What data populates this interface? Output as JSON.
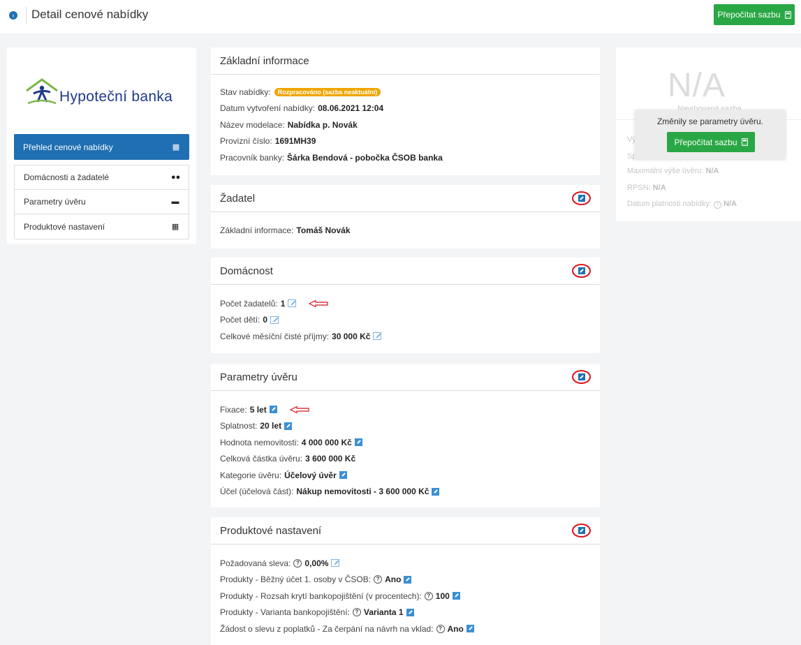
{
  "header": {
    "title": "Detail cenové nabídky",
    "recalc_button": "Přepočítat sazbu"
  },
  "logo": {
    "text": "Hypoteční banka"
  },
  "sidebar": {
    "active_item": "Přehled cenové nabídky",
    "items": [
      {
        "label": "Domácnosti a žadatelé",
        "icon": "users-icon"
      },
      {
        "label": "Parametry úvěru",
        "icon": "money-icon"
      },
      {
        "label": "Produktové nastavení",
        "icon": "calculator-icon"
      }
    ]
  },
  "basic_info": {
    "title": "Základní informace",
    "state_label": "Stav nabídky:",
    "state_badge": "Rozpracováno (sazba neaktuální)",
    "created_label": "Datum vytvoření nabídky:",
    "created_value": "08.06.2021 12:04",
    "model_label": "Název modelace:",
    "model_value": "Nabídka p. Novák",
    "temp_label": "Provizní číslo:",
    "temp_value": "1691MH39",
    "worker_label": "Pracovník banky:",
    "worker_value": "Šárka Bendová - pobočka ČSOB banka"
  },
  "applicant": {
    "title": "Žadatel",
    "info_label": "Základní informace:",
    "info_value": "Tomáš Novák"
  },
  "household": {
    "title": "Domácnost",
    "applicants_label": "Počet žadatelů:",
    "applicants_value": "1",
    "children_label": "Počet dětí:",
    "children_value": "0",
    "income_label": "Celkové měsíční čisté příjmy:",
    "income_value": "30 000 Kč"
  },
  "loan": {
    "title": "Parametry úvěru",
    "fixation_label": "Fixace:",
    "fixation_value": "5 let",
    "maturity_label": "Splatnost:",
    "maturity_value": "20 let",
    "property_label": "Hodnota nemovitosti:",
    "property_value": "4 000 000 Kč",
    "amount_label": "Celková částka úvěru:",
    "amount_value": "3 600 000 Kč",
    "category_label": "Kategorie úvěru:",
    "category_value": "Účelový úvěr",
    "purpose_label": "Účel (účelová část):",
    "purpose_value": "Nákup nemovitosti - 3 600 000 Kč"
  },
  "product": {
    "title": "Produktové nastavení",
    "discount_label": "Požadovaná sleva:",
    "discount_value": "0,00%",
    "account_label": "Produkty - Běžný účet 1. osoby v ČSOB:",
    "account_value": "Ano",
    "coverage_label": "Produkty - Rozsah krytí bankopojištění (v procentech):",
    "coverage_value": "100",
    "variant_label": "Produkty - Varianta bankopojištění:",
    "variant_value": "Varianta 1",
    "fee_label": "Žádost o slevu z poplatků - Za čerpání na návrh na vklad:",
    "fee_value": "Ano"
  },
  "summary": {
    "rate_value": "N/A",
    "rate_label": "Navrhovaná sazba",
    "row1_prefix": "Vý",
    "row2_prefix": "Sp",
    "max_label": "Maximální výše úvěru:",
    "max_value": "N/A",
    "rpsn_label": "RPSN:",
    "rpsn_value": "N/A",
    "validity_label": "Datum platnosti nabídky:",
    "validity_value": "N/A"
  },
  "overlay": {
    "message": "Změnily se parametry úvěru.",
    "button": "Přepočítat sazbu"
  },
  "colors": {
    "primary": "#1f6fb2",
    "success": "#29a745",
    "warning": "#f0a500",
    "annotation": "#d8141c"
  }
}
